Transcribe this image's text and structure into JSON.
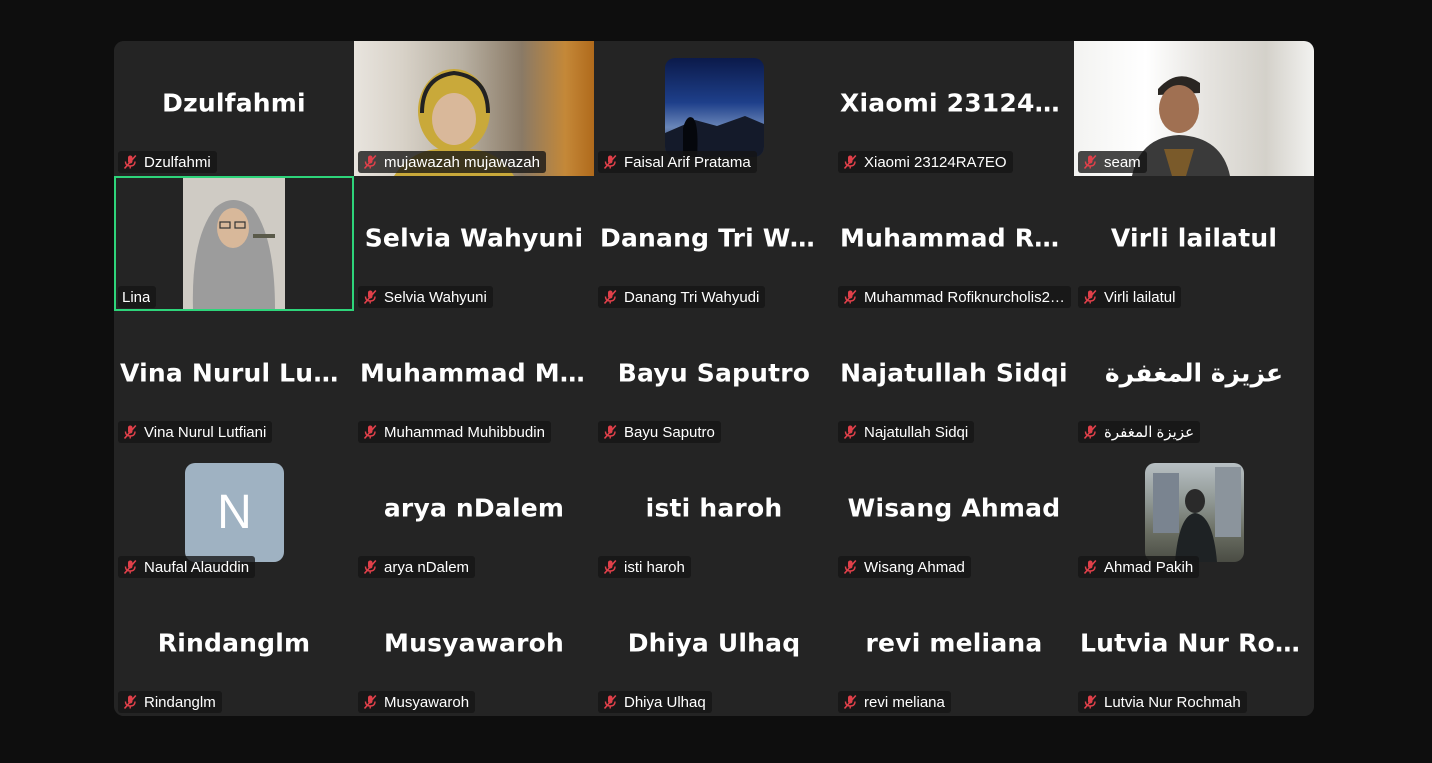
{
  "participants": [
    {
      "display": "Dzulfahmi",
      "label": "Dzulfahmi",
      "muted": true
    },
    {
      "display": "",
      "label": "mujawazah mujawazah",
      "muted": true,
      "video": "muja"
    },
    {
      "display": "",
      "label": "Faisal Arif Pratama",
      "muted": true,
      "avatar": "mountain"
    },
    {
      "display": "Xiaomi 23124R…",
      "label": "Xiaomi 23124RA7EO",
      "muted": true
    },
    {
      "display": "",
      "label": "seam",
      "muted": true,
      "video": "seam"
    },
    {
      "display": "",
      "label": "Lina",
      "muted": false,
      "video": "lina",
      "active": true
    },
    {
      "display": "Selvia Wahyuni",
      "label": "Selvia Wahyuni",
      "muted": true
    },
    {
      "display": "Danang Tri Wah…",
      "label": "Danang Tri Wahyudi",
      "muted": true
    },
    {
      "display": "Muhammad Ro…",
      "label": "Muhammad Rofiknurcholis2…",
      "muted": true
    },
    {
      "display": "Virli lailatul",
      "label": "Virli lailatul",
      "muted": true
    },
    {
      "display": "Vina Nurul Lutfi…",
      "label": "Vina Nurul Lutfiani",
      "muted": true
    },
    {
      "display": "Muhammad Mu…",
      "label": "Muhammad Muhibbudin",
      "muted": true
    },
    {
      "display": "Bayu Saputro",
      "label": "Bayu Saputro",
      "muted": true
    },
    {
      "display": "Najatullah Sidqi",
      "label": "Najatullah Sidqi",
      "muted": true
    },
    {
      "display": "عزيزة المغفرة",
      "label": "عزيزة المغفرة",
      "muted": true
    },
    {
      "display": "",
      "label": "Naufal Alauddin",
      "muted": true,
      "avatar": "letter",
      "letter": "N"
    },
    {
      "display": "arya nDalem",
      "label": "arya nDalem",
      "muted": true
    },
    {
      "display": "isti haroh",
      "label": "isti haroh",
      "muted": true
    },
    {
      "display": "Wisang Ahmad",
      "label": "Wisang Ahmad",
      "muted": true
    },
    {
      "display": "",
      "label": "Ahmad Pakih",
      "muted": true,
      "avatar": "street"
    },
    {
      "display": "Rindanglm",
      "label": "Rindanglm",
      "muted": true
    },
    {
      "display": "Musyawaroh",
      "label": "Musyawaroh",
      "muted": true
    },
    {
      "display": "Dhiya Ulhaq",
      "label": "Dhiya Ulhaq",
      "muted": true
    },
    {
      "display": "revi meliana",
      "label": "revi meliana",
      "muted": true
    },
    {
      "display": "Lutvia Nur Roc…",
      "label": "Lutvia Nur Rochmah",
      "muted": true
    }
  ],
  "colors": {
    "background": "#0e0e0e",
    "tile": "#242424",
    "active_border": "#2ed47a",
    "muted_mic": "#e0404a"
  }
}
